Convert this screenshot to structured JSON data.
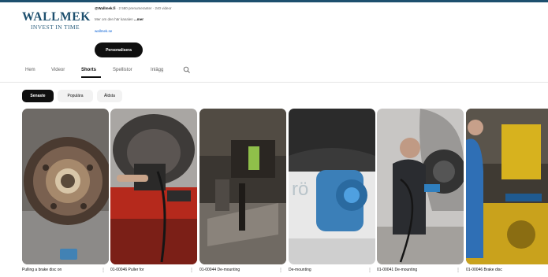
{
  "channel": {
    "logo_main": "WALLMEK",
    "logo_sub": "INVEST IN TIME",
    "handle": "@Wallmek.fi",
    "meta_rest": " · 2 580 prenumeranter · 240 videor",
    "description": "Mer om den här kanalen ",
    "description_more": "...mer",
    "link": "wallmek.se",
    "personalize_label": "Personalisera"
  },
  "tabs": [
    {
      "label": "Hem"
    },
    {
      "label": "Videor"
    },
    {
      "label": "Shorts"
    },
    {
      "label": "Spellistor"
    },
    {
      "label": "Inlägg"
    }
  ],
  "chips": [
    {
      "label": "Senaste"
    },
    {
      "label": "Populära"
    },
    {
      "label": "Äldsta"
    }
  ],
  "shorts": [
    {
      "title": "Pulling a brake disc on"
    },
    {
      "title": "01-00046 Puller for"
    },
    {
      "title": "01-00044 De-mounting"
    },
    {
      "title": "De-mounting"
    },
    {
      "title": "01-00041 De-mounting"
    },
    {
      "title": "01-00046 Brake disc"
    }
  ],
  "colors": {
    "brand": "#1d4f6e",
    "accent_blue": "#2f7fbf",
    "active_chip": "#0f0f0f"
  },
  "icons": {
    "tab_search": "search-icon",
    "short_menu": "more-vertical-icon"
  }
}
